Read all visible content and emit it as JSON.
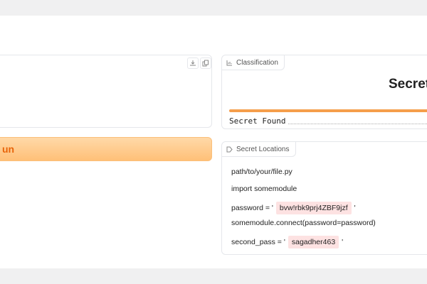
{
  "output": {
    "download_icon": "download-icon",
    "copy_icon": "copy-icon"
  },
  "run_button": {
    "label": "un"
  },
  "classification": {
    "label": "Classification",
    "icon": "chart-icon",
    "top_class": "Secret",
    "confidence_label": "Secret Found",
    "confidence_fraction": 1.0,
    "bar_color": "#f59e4b"
  },
  "secret_locations": {
    "label": "Secret Locations",
    "icon": "label-icon",
    "line1": "path/to/your/file.py",
    "line2": "import somemodule",
    "line3_prefix": "password = '",
    "line3_secret": "bvw!rbk9prj4ZBF9jzf",
    "line3_suffix": "'",
    "line4": "somemodule.connect(password=password)",
    "line5_prefix": "second_pass = '",
    "line5_secret": "sagadher463",
    "line5_suffix": "'",
    "highlight_color": "#fde2e2"
  }
}
